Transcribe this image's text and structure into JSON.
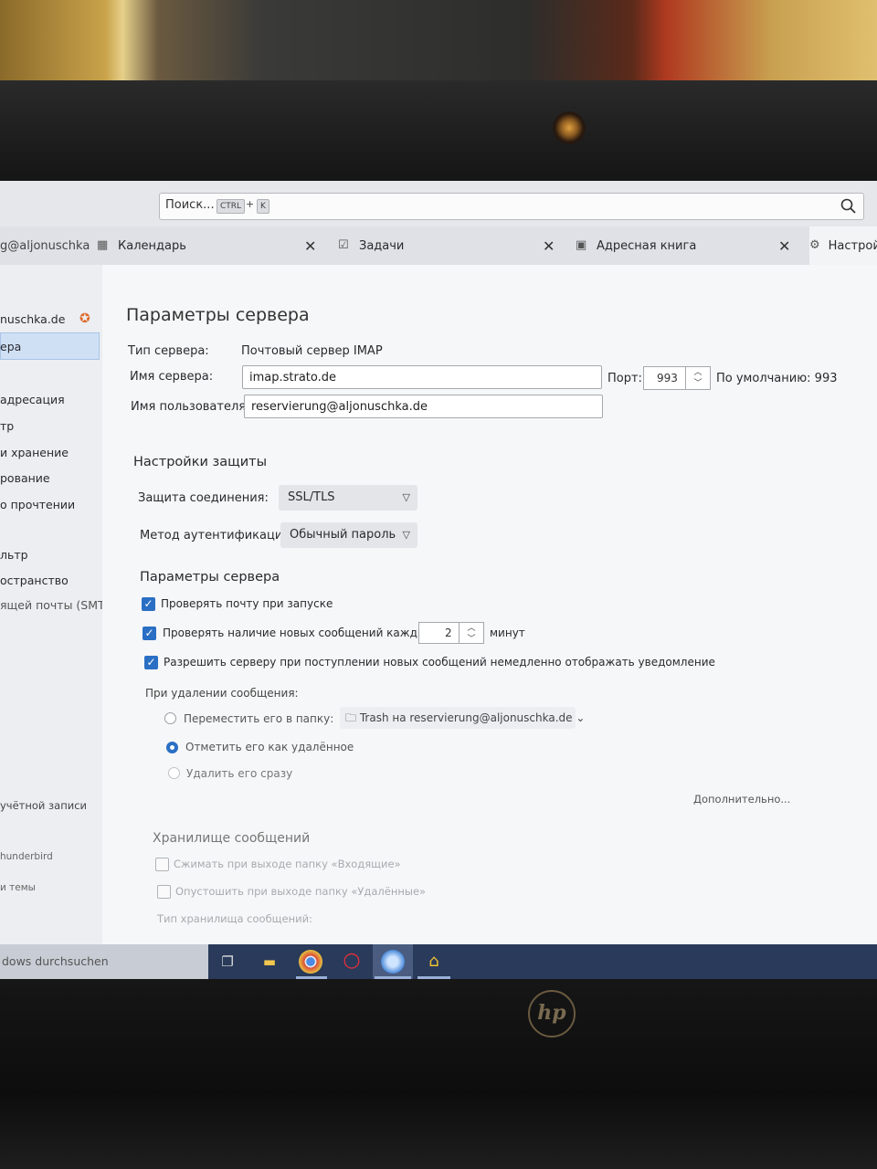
{
  "toolbar": {
    "search_placeholder": "Поиск...",
    "kbd_ctrl": "CTRL",
    "kbd_plus": "+",
    "kbd_k": "K"
  },
  "tabs": [
    {
      "label": "g@aljonuschka"
    },
    {
      "label": "Календарь"
    },
    {
      "label": "Задачи"
    },
    {
      "label": "Адресная книга"
    },
    {
      "label": "Настройки"
    }
  ],
  "sidebar": {
    "items": [
      {
        "label": "nuschka.de"
      },
      {
        "label": "ера"
      },
      {
        "label": "адресация"
      },
      {
        "label": "тр"
      },
      {
        "label": " и хранение"
      },
      {
        "label": "рование"
      },
      {
        "label": "о прочтении"
      },
      {
        "label": "льтр"
      },
      {
        "label": "остранство"
      },
      {
        "label": "ящей почты (SMTP)"
      },
      {
        "label": "учётной записи"
      },
      {
        "label": "hunderbird"
      },
      {
        "label": "и темы"
      }
    ]
  },
  "server": {
    "title": "Параметры сервера",
    "type_label": "Тип сервера:",
    "type_value": "Почтовый сервер IMAP",
    "name_label": "Имя сервера:",
    "name_value": "imap.strato.de",
    "port_label": "Порт:",
    "port_value": "993",
    "default_label": "По умолчанию: 993",
    "user_label": "Имя пользователя:",
    "user_value": "reservierung@aljonuschka.de"
  },
  "security": {
    "title": "Настройки защиты",
    "conn_label": "Защита соединения:",
    "conn_value": "SSL/TLS",
    "auth_label": "Метод аутентификации:",
    "auth_value": "Обычный пароль"
  },
  "settings": {
    "title": "Параметры сервера",
    "check_startup": "Проверять почту при запуске",
    "check_every": "Проверять наличие новых сообщений каждые",
    "interval": "2",
    "minutes": "минут",
    "allow_push": "Разрешить серверу при поступлении новых сообщений немедленно отображать уведомление",
    "on_delete": "При удалении сообщения:",
    "move_to": "Переместить его в папку:",
    "folder": "Trash на reservierung@aljonuschka.de",
    "mark_deleted": "Отметить его как удалённое",
    "delete_now": "Удалить его сразу",
    "advanced": "Дополнительно..."
  },
  "storage": {
    "title": "Хранилище сообщений",
    "compact": "Сжимать при выходе папку «Входящие»",
    "empty_trash": "Опустошить при выходе папку «Удалённые»",
    "type_label": "Тип хранилища сообщений:"
  },
  "taskbar": {
    "search": "dows durchsuchen"
  },
  "colors": {
    "accent": "#2a6fc4",
    "taskbar": "#2a3a5a"
  }
}
